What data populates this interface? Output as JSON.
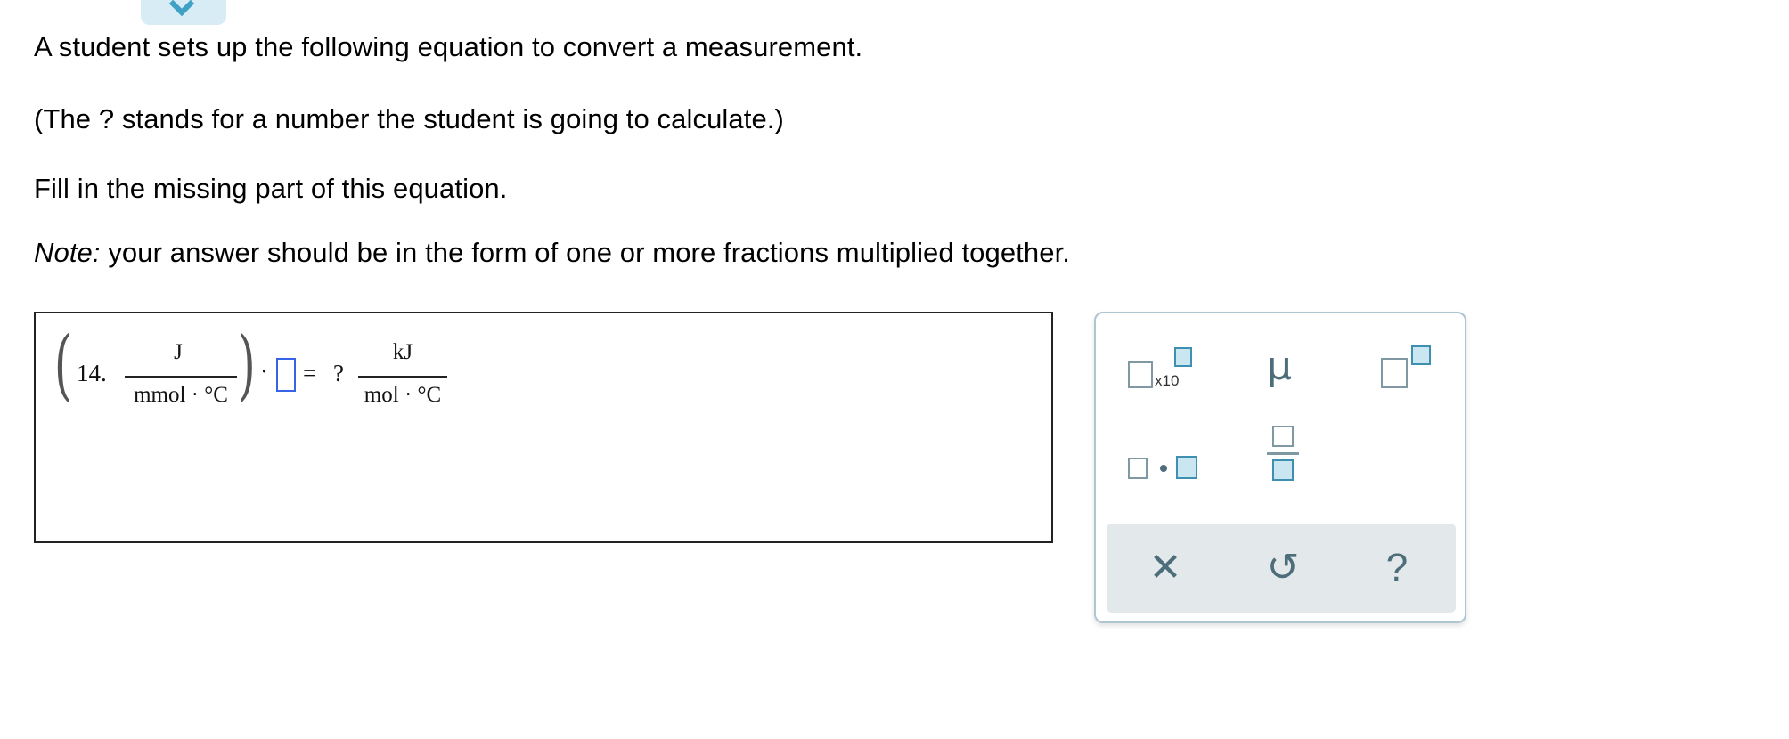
{
  "instructions": {
    "line1": "A student sets up the following equation to convert a measurement.",
    "line2": "(The ? stands for a number the student is going to calculate.)",
    "line3": "Fill in the missing part of this equation.",
    "note_label": "Note:",
    "note_text": " your answer should be in the form of one or more fractions multiplied together."
  },
  "equation": {
    "coefficient": "14.",
    "left_num": "J",
    "left_den": "mmol · °C",
    "multiply": "·",
    "equals": "=",
    "unknown": "?",
    "right_num": "kJ",
    "right_den": "mol · °C"
  },
  "palette": {
    "sci_notation_label": "x10",
    "mu_symbol": "μ",
    "clear_symbol": "✕",
    "undo_symbol": "↺",
    "help_symbol": "?",
    "accent_color": "#3f8fb0",
    "icon_color": "#4d6d7a"
  }
}
